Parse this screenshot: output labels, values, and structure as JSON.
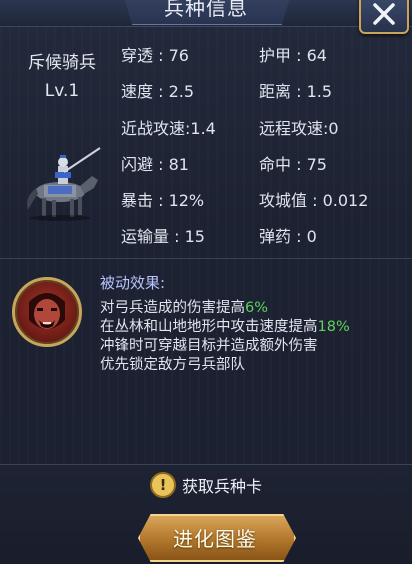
{
  "header": {
    "title": "兵种信息"
  },
  "unit": {
    "name": "斥候骑兵",
    "level": "Lv.1"
  },
  "stats": {
    "penetration": "穿透 : 76",
    "armor": "护甲 : 64",
    "speed": "速度 : 2.5",
    "range": "距离 : 1.5",
    "melee_attack_speed": "近战攻速:1.4",
    "ranged_attack_speed": "远程攻速:0",
    "dodge": "闪避 : 81",
    "hit": "命中 : 75",
    "crit": "暴击 : 12%",
    "siege": "攻城值 : 0.012",
    "transport": "运输量 : 15",
    "ammo": "弹药 : 0"
  },
  "passive": {
    "title": "被动效果:",
    "line1": {
      "text": "对弓兵造成的伤害提高",
      "value": "6%"
    },
    "line2": {
      "text": "在丛林和山地地形中攻击速度提高",
      "value": "18%"
    },
    "line3": "冲锋时可穿越目标并造成额外伤害",
    "line4": "优先锁定敌方弓兵部队"
  },
  "footer": {
    "obtain_icon": "!",
    "obtain_label": "获取兵种卡",
    "evolve_label": "进化图鉴"
  },
  "icons": {
    "close": "close-icon",
    "obtain": "exclamation-icon",
    "portrait": "red-warrior-portrait"
  },
  "colors": {
    "highlight": "#5fd35a",
    "gold_border": "#c9a45a",
    "passive_title": "#b9c4ff"
  }
}
